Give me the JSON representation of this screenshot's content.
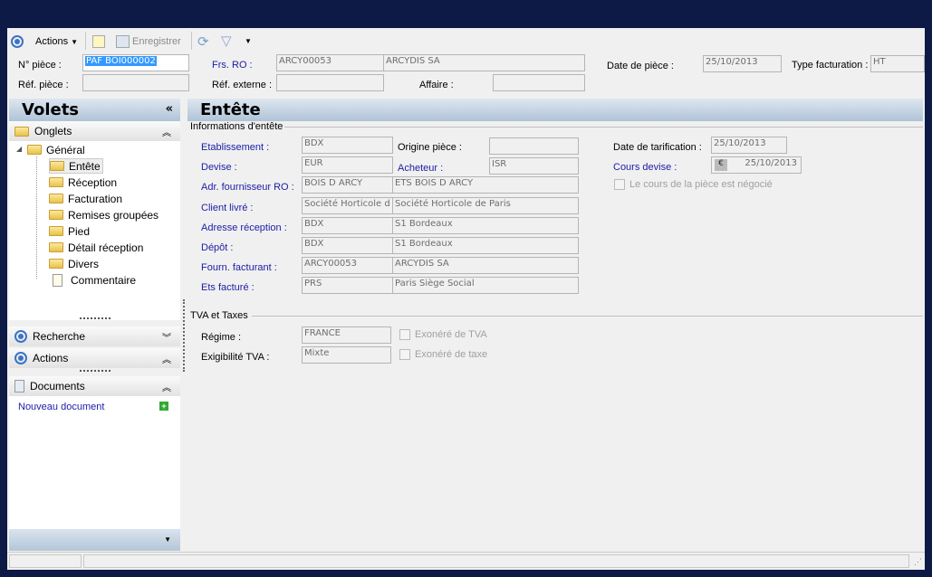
{
  "toolbar": {
    "actions": "Actions",
    "save": "Enregistrer"
  },
  "header": {
    "num_piece_label": "N° pièce :",
    "num_piece": "PAF BOI000002",
    "ref_piece_label": "Réf. pièce :",
    "ref_piece": "",
    "frs_label": "Frs. RO :",
    "frs_code": "ARCY00053",
    "frs_name": "ARCYDIS SA",
    "ref_ext_label": "Réf. externe :",
    "ref_ext": "",
    "affaire_label": "Affaire :",
    "affaire": "",
    "date_label": "Date de pièce :",
    "date": "25/10/2013",
    "type_label": "Type facturation :",
    "type": "HT"
  },
  "sidebar": {
    "title": "Volets",
    "onglets": "Onglets",
    "root": "Général",
    "items": [
      "Entête",
      "Réception",
      "Facturation",
      "Remises groupées",
      "Pied",
      "Détail réception",
      "Divers",
      "Commentaire"
    ],
    "recherche": "Recherche",
    "actions": "Actions",
    "documents": "Documents",
    "new_doc": "Nouveau document"
  },
  "main": {
    "title": "Entête",
    "group1": "Informations d'entête",
    "group2": "TVA et Taxes",
    "rows": [
      {
        "label": "Etablissement :",
        "v1": "BDX"
      },
      {
        "label": "Devise :",
        "v1": "EUR"
      },
      {
        "label": "Adr. fournisseur RO :",
        "v1": "BOIS D ARCY",
        "v2": "ETS BOIS D ARCY"
      },
      {
        "label": "Client livré :",
        "v1": "Société Horticole d",
        "v2": "Société Horticole de Paris"
      },
      {
        "label": "Adresse réception :",
        "v1": "BDX",
        "v2": "S1 Bordeaux"
      },
      {
        "label": "Dépôt :",
        "v1": "BDX",
        "v2": "S1 Bordeaux"
      },
      {
        "label": "Fourn. facturant :",
        "v1": "ARCY00053",
        "v2": "ARCYDIS SA"
      },
      {
        "label": "Ets facturé :",
        "v1": "PRS",
        "v2": "Paris Siège Social"
      }
    ],
    "origine_label": "Origine pièce :",
    "origine": "",
    "acheteur_label": "Acheteur :",
    "acheteur": "ISR",
    "date_tarif_label": "Date de tarification :",
    "date_tarif": "25/10/2013",
    "cours_label": "Cours devise :",
    "cours": "25/10/2013",
    "negocie": "Le cours de la pièce est négocié",
    "regime_label": "Régime :",
    "regime": "FRANCE",
    "exig_label": "Exigibilité TVA :",
    "exig": "Mixte",
    "exo_tva": "Exonéré de TVA",
    "exo_taxe": "Exonéré de taxe"
  }
}
